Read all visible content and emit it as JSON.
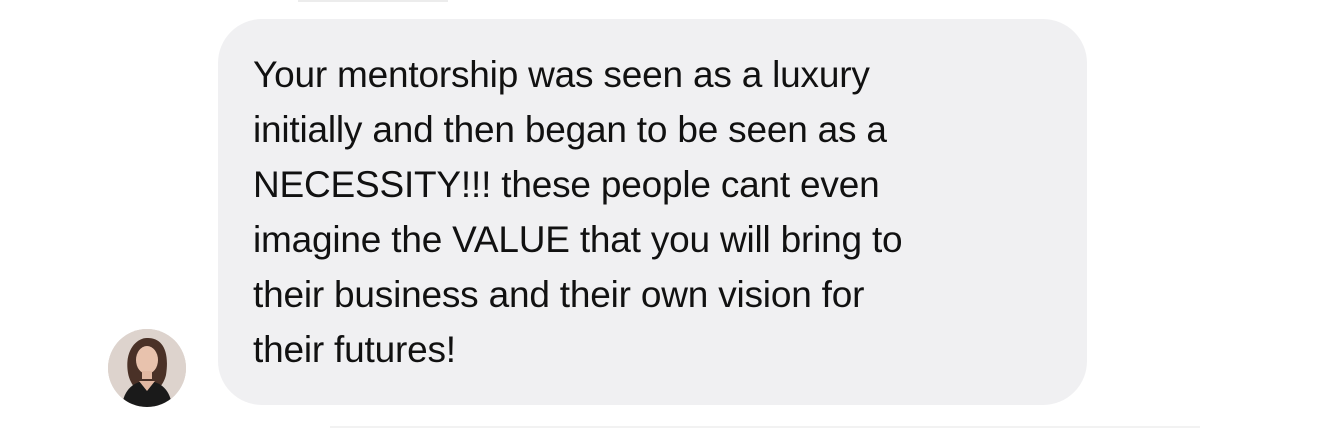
{
  "conversation": {
    "messages": [
      {
        "sender_avatar": "person-avatar",
        "text": "Your mentorship was seen as a luxury\ninitially and then began to be seen as a\nNECESSITY!!! these people cant even\nimagine the VALUE that you will bring to\ntheir business and their own vision for\ntheir futures!"
      }
    ]
  },
  "colors": {
    "background": "#ffffff",
    "bubble": "#f0f0f2",
    "text": "#111111"
  }
}
